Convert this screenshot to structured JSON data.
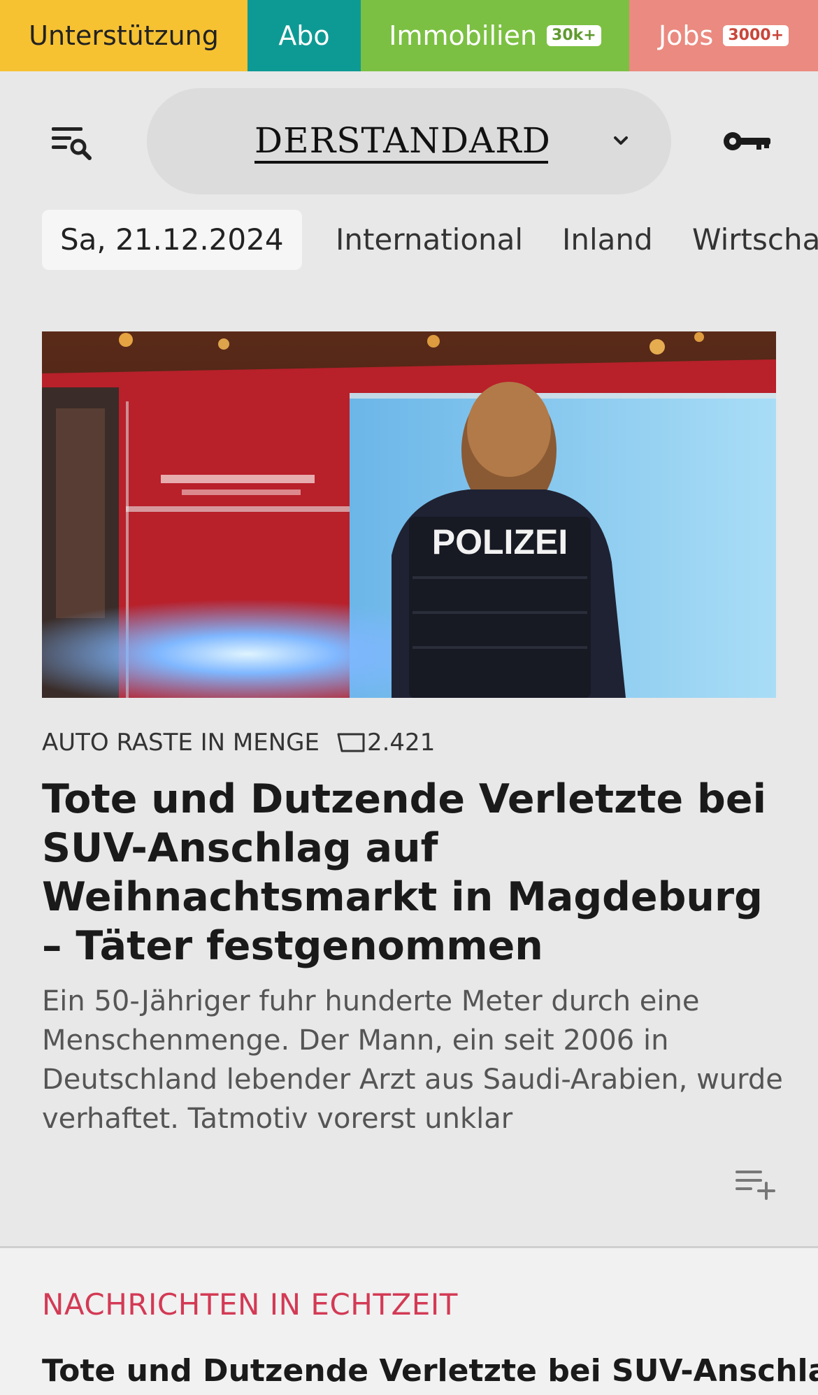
{
  "topbar": {
    "support": "Unterstützung",
    "abo": "Abo",
    "immobilien": "Immobilien",
    "immobilien_badge": "30k+",
    "jobs": "Jobs",
    "jobs_badge": "3000+"
  },
  "header": {
    "logo": "DERSTANDARD",
    "icons": [
      "menu-search-icon",
      "chevron-down-icon",
      "key-icon"
    ]
  },
  "nav": {
    "date": "Sa, 21.12.2024",
    "items": [
      "International",
      "Inland",
      "Wirtschaft"
    ]
  },
  "article": {
    "image_text": "POLIZEI",
    "kicker": "AUTO RASTE IN MENGE",
    "comments": "2.421",
    "headline": "Tote und Dutzende Verletzte bei SUV-Anschlag auf Weihnachtsmarkt in Magdeburg – Täter festgenommen",
    "teaser": "Ein 50-Jähriger fuhr hunderte Meter durch eine Menschenmenge. Der Mann, ein seit 2006 in Deutschland lebender Arzt aus Saudi-Arabien, wurde verhaftet. Tatmotiv vorerst unklar"
  },
  "live": {
    "title": "NACHRICHTEN IN ECHTZEIT",
    "first_headline": "Tote und Dutzende Verletzte bei SUV-Anschlag"
  },
  "colors": {
    "support": "#f6c232",
    "abo": "#0e9a94",
    "immobilien": "#7cc043",
    "jobs": "#eb8a80",
    "live_accent": "#d33a55"
  }
}
